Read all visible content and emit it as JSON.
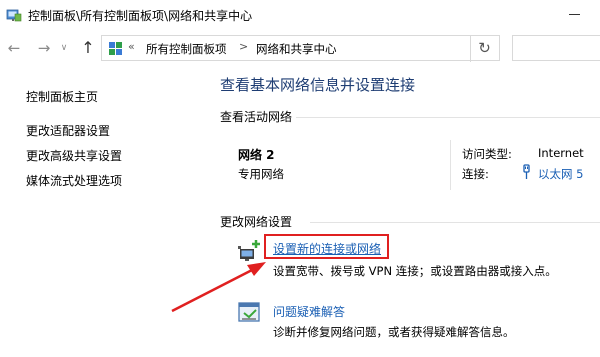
{
  "window": {
    "title": "控制面板\\所有控制面板项\\网络和共享中心"
  },
  "address_bar": {
    "chevrons": "«",
    "segments": [
      "所有控制面板项",
      "网络和共享中心"
    ],
    "separator": ">"
  },
  "sidebar": {
    "home": "控制面板主页",
    "links": [
      "更改适配器设置",
      "更改高级共享设置",
      "媒体流式处理选项"
    ]
  },
  "main": {
    "heading": "查看基本网络信息并设置连接",
    "active_networks_title": "查看活动网络",
    "network": {
      "name": "网络 2",
      "type": "专用网络",
      "access_type_label": "访问类型:",
      "access_type_value": "Internet",
      "connections_label": "连接:",
      "connections_value": "以太网 5"
    },
    "change_settings_title": "更改网络设置",
    "tasks": [
      {
        "label": "设置新的连接或网络",
        "description": "设置宽带、拨号或 VPN 连接；或设置路由器或接入点。",
        "icon": "network-setup-icon"
      },
      {
        "label": "问题疑难解答",
        "description": "诊断并修复网络问题，或者获得疑难解答信息。",
        "icon": "troubleshoot-icon"
      }
    ]
  },
  "colors": {
    "heading": "#1e3d73",
    "link": "#1a5fb4",
    "annotation": "#e02020"
  }
}
